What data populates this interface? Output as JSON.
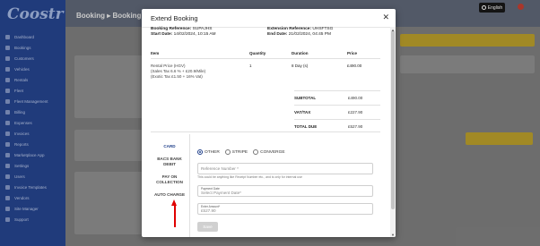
{
  "app": {
    "brand": "Coostr",
    "header_title": "Booking ▸ Booking",
    "language": "English",
    "nav_items": [
      "Dashboard",
      "Bookings",
      "Customers",
      "Vehicles",
      "Rentals",
      "Fleet",
      "Fleet Management",
      "Billing",
      "Expenses",
      "Invoices",
      "Reports",
      "Marketplace App",
      "Settings",
      "Users",
      "Invoice Templates",
      "Vendors",
      "Site Manager",
      "Support"
    ]
  },
  "modal": {
    "title": "Extend Booking",
    "close_icon": "close-icon",
    "booking_reference_label": "Booking Reference:",
    "booking_reference": "SUPAJHS",
    "extension_reference_label": "Extension Reference:",
    "extension_reference": "UHSFTSG",
    "start_date_label": "Start Date:",
    "start_date": "14/02/2024, 10:15 AM",
    "end_date_label": "End Date:",
    "end_date": "21/02/2024, 04:45 PM"
  },
  "items_table": {
    "headers": [
      "Item",
      "Quantity",
      "Duration",
      "Price"
    ],
    "rows": [
      {
        "item_lines": [
          "Rental Price (HGV)",
          "(Sales Tax 6.6 % + £20.9/Mile)",
          "(Exotic Tax £1.50 + 16% Vat)"
        ],
        "quantity": "1",
        "duration": "8 Day (s)",
        "price": "£490.00"
      }
    ]
  },
  "totals": {
    "subtotal_label": "SUBTOTAL",
    "subtotal": "£490.00",
    "vat_label": "VAT/TAX",
    "vat": "£227.90",
    "total_label": "TOTAL DUE",
    "total": "£527.90"
  },
  "payment": {
    "tabs": [
      "CARD",
      "BACS BANK DEBIT",
      "PAY ON COLLECTION",
      "AUTO CHARGE"
    ],
    "active_tab": "CARD",
    "options": [
      "OTHER",
      "STRIPE",
      "CONVERGE"
    ],
    "selected_option": "OTHER",
    "reference_placeholder": "Reference Number *",
    "reference_hint": "This could be anything like Receipt Number etc., and is only for internal use",
    "payment_date_label": "Payment Date",
    "payment_date_placeholder": "Select Payment Date*",
    "amount_label": "Enter Amount*",
    "amount_value": "£527.90",
    "save_label": "Save"
  },
  "colors": {
    "brand_blue": "#1f3f8a",
    "annotation_arrow": "#e00000",
    "gold_button": "#b79a25"
  }
}
